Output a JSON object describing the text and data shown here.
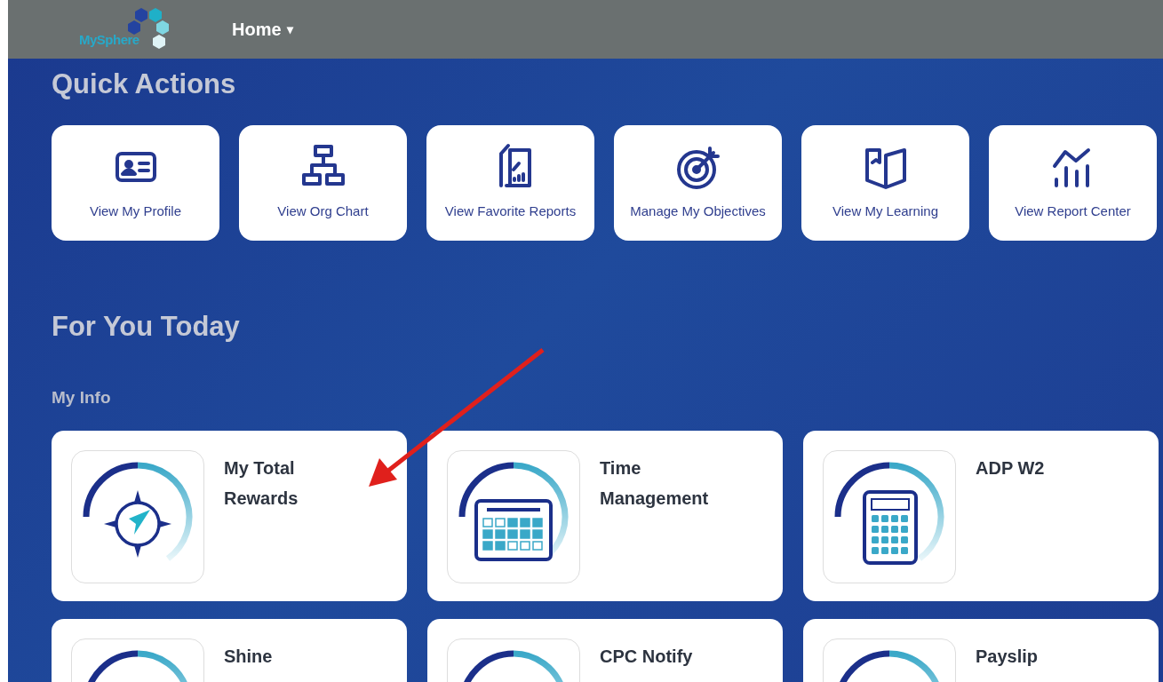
{
  "header": {
    "logo": "MySphere",
    "nav": {
      "label": "Home",
      "caret": "▾"
    }
  },
  "quick_actions": {
    "title": "Quick Actions",
    "items": [
      {
        "label": "View My Profile",
        "kind": "profile"
      },
      {
        "label": "View Org Chart",
        "kind": "org"
      },
      {
        "label": "View Favorite Reports",
        "kind": "reports"
      },
      {
        "label": "Manage My Objectives",
        "kind": "target"
      },
      {
        "label": "View My Learning",
        "kind": "book"
      },
      {
        "label": "View Report Center",
        "kind": "chart"
      }
    ]
  },
  "for_you_today": {
    "title": "For You Today",
    "section": "My Info",
    "tiles": [
      {
        "title": "My Total Rewards",
        "kind": "compass"
      },
      {
        "title": "Time Management",
        "kind": "calendar"
      },
      {
        "title": "ADP W2",
        "kind": "calculator"
      },
      {
        "title": "Shine"
      },
      {
        "title": "CPC Notify"
      },
      {
        "title": "Payslip"
      }
    ]
  },
  "annotation": {
    "kind": "arrow"
  }
}
